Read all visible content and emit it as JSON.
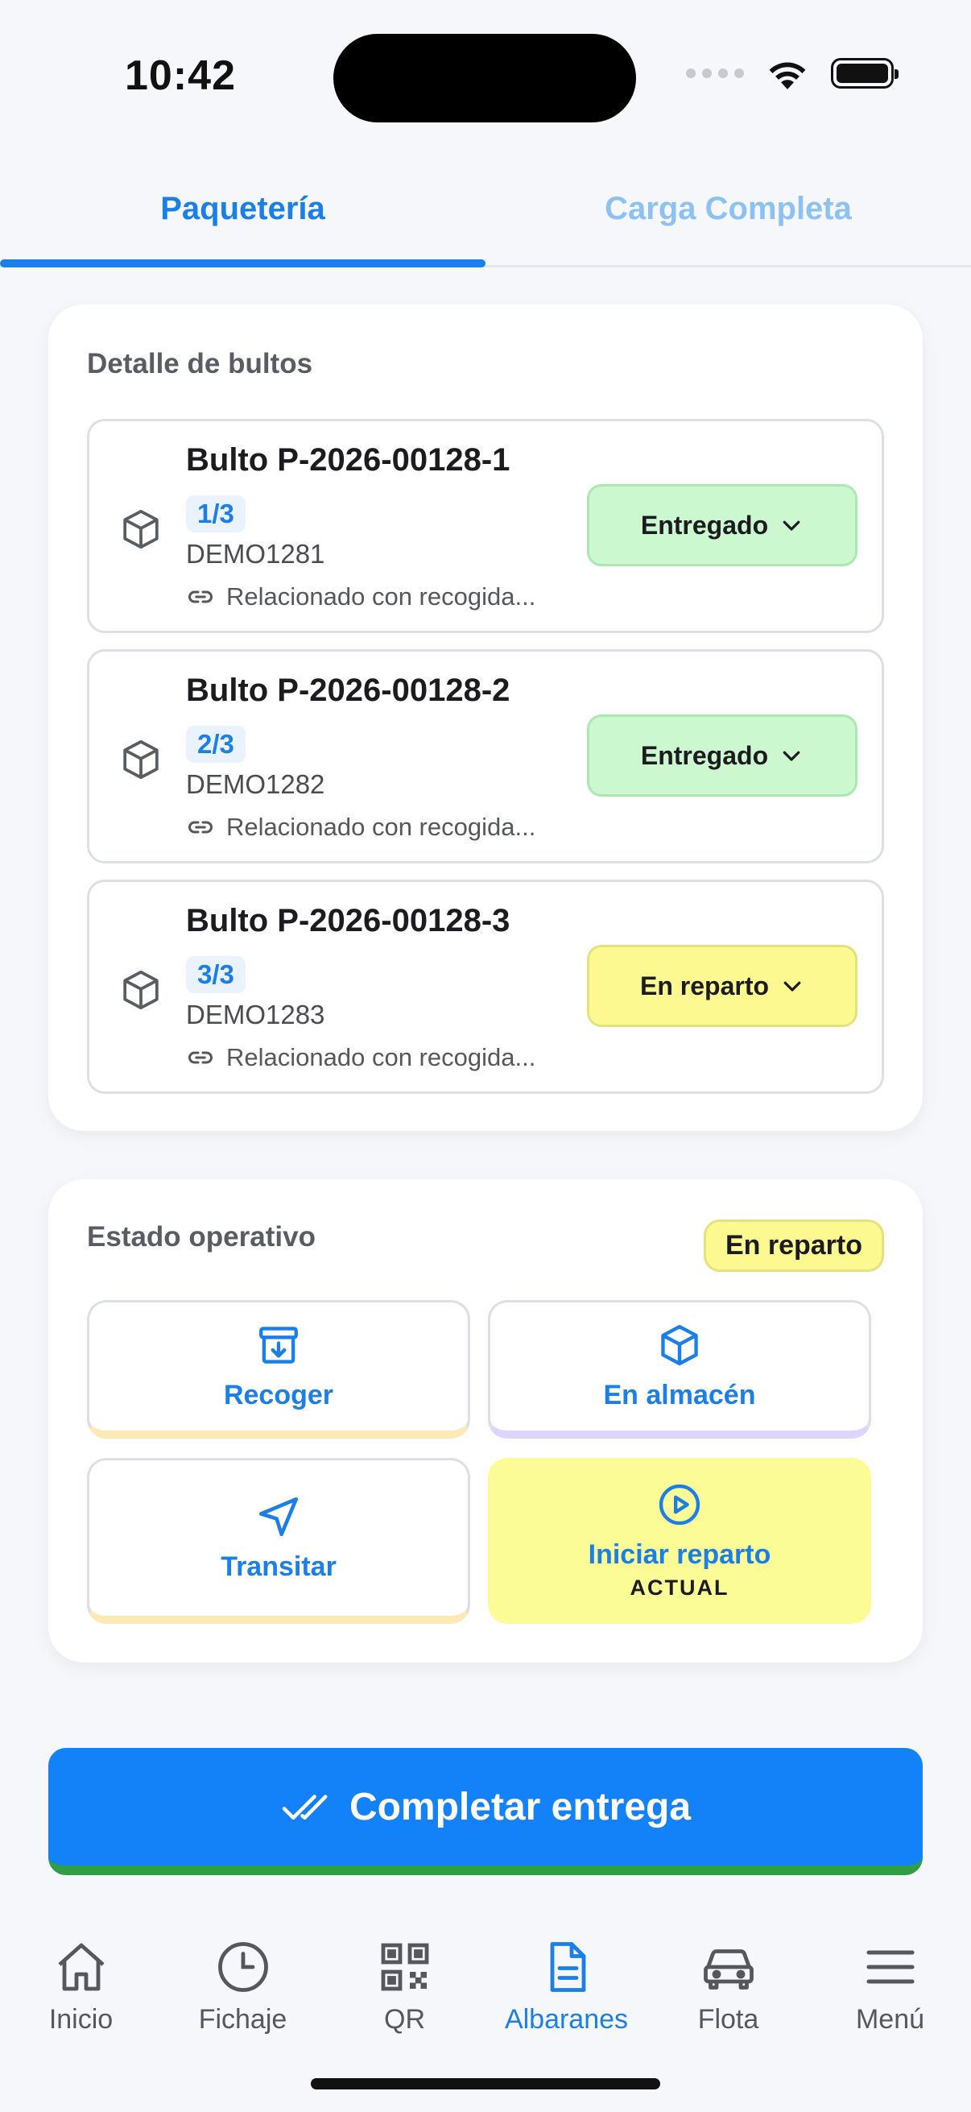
{
  "status_bar": {
    "time": "10:42"
  },
  "tabs": [
    {
      "label": "Paquetería",
      "active": true
    },
    {
      "label": "Carga Completa",
      "active": false
    }
  ],
  "bultos": {
    "title": "Detalle de bultos",
    "items": [
      {
        "name": "Bulto P-2026-00128-1",
        "count": "1/3",
        "code": "DEMO1281",
        "related": "Relacionado con recogida...",
        "state": "Entregado"
      },
      {
        "name": "Bulto P-2026-00128-2",
        "count": "2/3",
        "code": "DEMO1282",
        "related": "Relacionado con recogida...",
        "state": "Entregado"
      },
      {
        "name": "Bulto P-2026-00128-3",
        "count": "3/3",
        "code": "DEMO1283",
        "related": "Relacionado con recogida...",
        "state": "En reparto"
      }
    ]
  },
  "estado": {
    "title": "Estado operativo",
    "badge": "En reparto",
    "actions": {
      "recoger": "Recoger",
      "almacen": "En almacén",
      "transitar": "Transitar",
      "iniciar": "Iniciar reparto",
      "iniciar_sub": "ACTUAL"
    }
  },
  "primary_button": "Completar entrega",
  "nav": [
    {
      "label": "Inicio",
      "icon": "home-icon"
    },
    {
      "label": "Fichaje",
      "icon": "clock-icon"
    },
    {
      "label": "QR",
      "icon": "qr-code-icon"
    },
    {
      "label": "Albaranes",
      "icon": "document-icon",
      "active": true
    },
    {
      "label": "Flota",
      "icon": "car-icon"
    },
    {
      "label": "Menú",
      "icon": "menu-icon"
    }
  ],
  "colors": {
    "accent": "#1a7fe8",
    "primary_button": "#1381f8",
    "delivered": "#cbf8cf",
    "in_delivery": "#fbf98f"
  }
}
